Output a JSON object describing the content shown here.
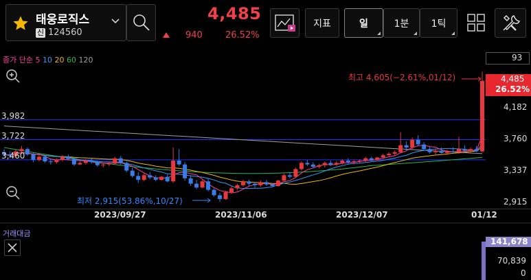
{
  "colors": {
    "up": "#e8383d",
    "down": "#3a7be8",
    "ma5": "#ff3fa0",
    "ma10": "#2f9bff",
    "ma20": "#f0b800",
    "ma60": "#29b64a",
    "ma120": "#a0a0a0",
    "hline": "#2233ff"
  },
  "header": {
    "stock_name": "태웅로직스",
    "market_badge": "신",
    "stock_code": "124560",
    "price": "4,485",
    "change_amount": "940",
    "change_pct": "26.52%",
    "indicator_label": "지표",
    "periods": [
      {
        "label": "일",
        "active": true
      },
      {
        "label": "1분",
        "active": false
      },
      {
        "label": "1틱",
        "active": false
      }
    ]
  },
  "indicator_bar": {
    "ma_title": "종가 단순",
    "ma5": "5",
    "ma10": "10",
    "ma20": "20",
    "ma60": "60",
    "ma120": "120",
    "right_box": "93"
  },
  "chart_data": {
    "type": "candlestick",
    "annotations": {
      "high": "최고 4,605(−2.61%,01/12)",
      "low": "최저 2,915(53.86%,10/27)"
    },
    "y_axis_ticks": [
      "4,485",
      "4,182",
      "3,760",
      "3,337",
      "2,915"
    ],
    "y_axis_current": "4,485",
    "y_axis_current_pct": "26.52%",
    "left_levels": [
      "3,982",
      "3,722",
      "3,460"
    ],
    "x_ticks": [
      "2023/09/27",
      "2023/11/06",
      "2023/12/07",
      "01/12"
    ],
    "levels": [
      3982,
      3722,
      3460
    ],
    "ylim": [
      2915,
      4605
    ],
    "candles": [
      [
        3560,
        3600,
        3500,
        3530
      ],
      [
        3530,
        3570,
        3480,
        3510
      ],
      [
        3510,
        3590,
        3490,
        3570
      ],
      [
        3570,
        3640,
        3540,
        3600
      ],
      [
        3600,
        3620,
        3510,
        3530
      ],
      [
        3530,
        3560,
        3430,
        3460
      ],
      [
        3460,
        3520,
        3440,
        3500
      ],
      [
        3500,
        3510,
        3420,
        3440
      ],
      [
        3440,
        3470,
        3400,
        3430
      ],
      [
        3430,
        3480,
        3410,
        3460
      ],
      [
        3460,
        3520,
        3440,
        3500
      ],
      [
        3500,
        3530,
        3450,
        3470
      ],
      [
        3470,
        3480,
        3380,
        3400
      ],
      [
        3400,
        3440,
        3390,
        3420
      ],
      [
        3420,
        3470,
        3400,
        3450
      ],
      [
        3450,
        3480,
        3410,
        3430
      ],
      [
        3430,
        3450,
        3370,
        3390
      ],
      [
        3390,
        3420,
        3360,
        3400
      ],
      [
        3400,
        3430,
        3380,
        3410
      ],
      [
        3410,
        3500,
        3400,
        3480
      ],
      [
        3480,
        3510,
        3400,
        3420
      ],
      [
        3420,
        3440,
        3300,
        3320
      ],
      [
        3320,
        3360,
        3230,
        3250
      ],
      [
        3250,
        3300,
        3160,
        3200
      ],
      [
        3200,
        3280,
        3180,
        3260
      ],
      [
        3260,
        3300,
        3210,
        3230
      ],
      [
        3230,
        3260,
        3180,
        3200
      ],
      [
        3200,
        3250,
        3190,
        3240
      ],
      [
        3240,
        3270,
        3170,
        3180
      ],
      [
        3180,
        3620,
        3160,
        3450
      ],
      [
        3450,
        3600,
        3380,
        3400
      ],
      [
        3400,
        3430,
        3190,
        3220
      ],
      [
        3220,
        3260,
        3120,
        3150
      ],
      [
        3150,
        3200,
        3080,
        3100
      ],
      [
        3100,
        3200,
        3090,
        3180
      ],
      [
        3180,
        3220,
        3050,
        3070
      ],
      [
        3070,
        3090,
        2980,
        3000
      ],
      [
        3000,
        3030,
        2915,
        2950
      ],
      [
        2950,
        3060,
        2940,
        3040
      ],
      [
        3040,
        3110,
        3020,
        3090
      ],
      [
        3090,
        3150,
        3070,
        3130
      ],
      [
        3130,
        3200,
        3110,
        3180
      ],
      [
        3180,
        3200,
        3120,
        3150
      ],
      [
        3150,
        3170,
        3100,
        3130
      ],
      [
        3130,
        3190,
        3110,
        3170
      ],
      [
        3170,
        3200,
        3120,
        3140
      ],
      [
        3140,
        3160,
        3100,
        3120
      ],
      [
        3120,
        3200,
        3110,
        3190
      ],
      [
        3190,
        3280,
        3180,
        3260
      ],
      [
        3260,
        3300,
        3220,
        3240
      ],
      [
        3240,
        3360,
        3230,
        3340
      ],
      [
        3340,
        3440,
        3320,
        3420
      ],
      [
        3420,
        3460,
        3380,
        3400
      ],
      [
        3400,
        3430,
        3350,
        3370
      ],
      [
        3370,
        3410,
        3350,
        3390
      ],
      [
        3390,
        3440,
        3360,
        3420
      ],
      [
        3420,
        3450,
        3380,
        3400
      ],
      [
        3400,
        3440,
        3380,
        3420
      ],
      [
        3420,
        3470,
        3400,
        3450
      ],
      [
        3450,
        3480,
        3410,
        3430
      ],
      [
        3430,
        3460,
        3400,
        3440
      ],
      [
        3440,
        3470,
        3420,
        3450
      ],
      [
        3450,
        3500,
        3430,
        3480
      ],
      [
        3480,
        3500,
        3440,
        3460
      ],
      [
        3460,
        3500,
        3450,
        3490
      ],
      [
        3490,
        3540,
        3470,
        3520
      ],
      [
        3520,
        3560,
        3500,
        3540
      ],
      [
        3540,
        3580,
        3510,
        3560
      ],
      [
        3560,
        3820,
        3550,
        3650
      ],
      [
        3650,
        3700,
        3580,
        3620
      ],
      [
        3620,
        3750,
        3600,
        3720
      ],
      [
        3720,
        3780,
        3640,
        3660
      ],
      [
        3660,
        3690,
        3580,
        3600
      ],
      [
        3600,
        3630,
        3540,
        3560
      ],
      [
        3560,
        3600,
        3520,
        3580
      ],
      [
        3580,
        3620,
        3540,
        3550
      ],
      [
        3550,
        3590,
        3520,
        3570
      ],
      [
        3570,
        3620,
        3540,
        3560
      ],
      [
        3560,
        3760,
        3540,
        3600
      ],
      [
        3600,
        3650,
        3560,
        3580
      ],
      [
        3580,
        3620,
        3550,
        3600
      ],
      [
        3600,
        3640,
        3560,
        3570
      ],
      [
        3570,
        4605,
        3560,
        4485
      ]
    ],
    "volume_label": "거래대금",
    "volume_ticks": [
      "141,678",
      "70,839",
      "0"
    ]
  }
}
